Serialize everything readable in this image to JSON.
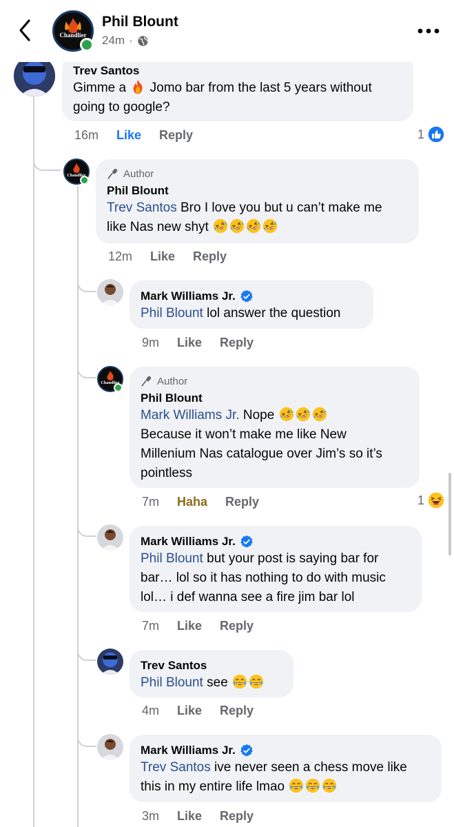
{
  "header": {
    "name": "Phil Blount",
    "time": "24m",
    "dot": "·",
    "logo_text": "Chandlier"
  },
  "icons": {
    "back": "chevron-left-icon",
    "privacy": "globe-icon",
    "more": "more-horizontal-icon",
    "author": "microphone-icon",
    "verified": "verified-badge-icon",
    "like_reaction": "thumbs-up-reaction-icon",
    "haha_reaction": "laughing-reaction-icon"
  },
  "colors": {
    "mention": "#2a4f8f",
    "like_active": "#1877f2",
    "haha_active": "#8a6d1c",
    "bubble": "#f0f2f5",
    "online": "#31a24c",
    "verified": "#1877f2"
  },
  "comments": [
    {
      "name": "Trev Santos",
      "line1_a": "Gimme a ",
      "line1_b": " Jomo bar from the last 5 years without",
      "line2": "going to google?",
      "emoji": "fire",
      "time": "16m",
      "like": "Like",
      "reply": "Reply",
      "reaction_count": "1"
    },
    {
      "author_label": "Author",
      "name": "Phil Blount",
      "mention": "Trev Santos",
      "line1": " Bro I love you but u can’t make me",
      "line2": "like Nas new shyt",
      "emoji": "rolling-laugh",
      "time": "12m",
      "like": "Like",
      "reply": "Reply"
    },
    {
      "name": "Mark Williams Jr.",
      "mention": "Phil Blount",
      "line1": " lol answer the question",
      "time": "9m",
      "like": "Like",
      "reply": "Reply"
    },
    {
      "author_label": "Author",
      "name": "Phil Blount",
      "mention": "Mark Williams Jr.",
      "line1": " Nope",
      "line2": "Because it won’t make me like New",
      "line3": "Millenium Nas catalogue over Jim’s so it’s",
      "line4": "pointless",
      "emoji": "rolling-laugh",
      "time": "7m",
      "like": "Haha",
      "reply": "Reply",
      "reaction_count": "1"
    },
    {
      "name": "Mark Williams Jr.",
      "mention": "Phil Blount",
      "line1": " but your post is saying bar for",
      "line2": "bar… lol so it has nothing to do with music",
      "line3": "lol… i def wanna see a fire jim bar lol",
      "time": "7m",
      "like": "Like",
      "reply": "Reply"
    },
    {
      "name": "Trev Santos",
      "mention": "Phil Blount",
      "line1": " see",
      "emoji": "tears-of-joy",
      "time": "4m",
      "like": "Like",
      "reply": "Reply"
    },
    {
      "name": "Mark Williams Jr.",
      "mention": "Trev Santos",
      "line1": " ive never seen a chess move like",
      "line2": "this in my entire life lmao",
      "emoji": "tears-of-joy",
      "time": "3m",
      "like": "Like",
      "reply": "Reply"
    }
  ]
}
